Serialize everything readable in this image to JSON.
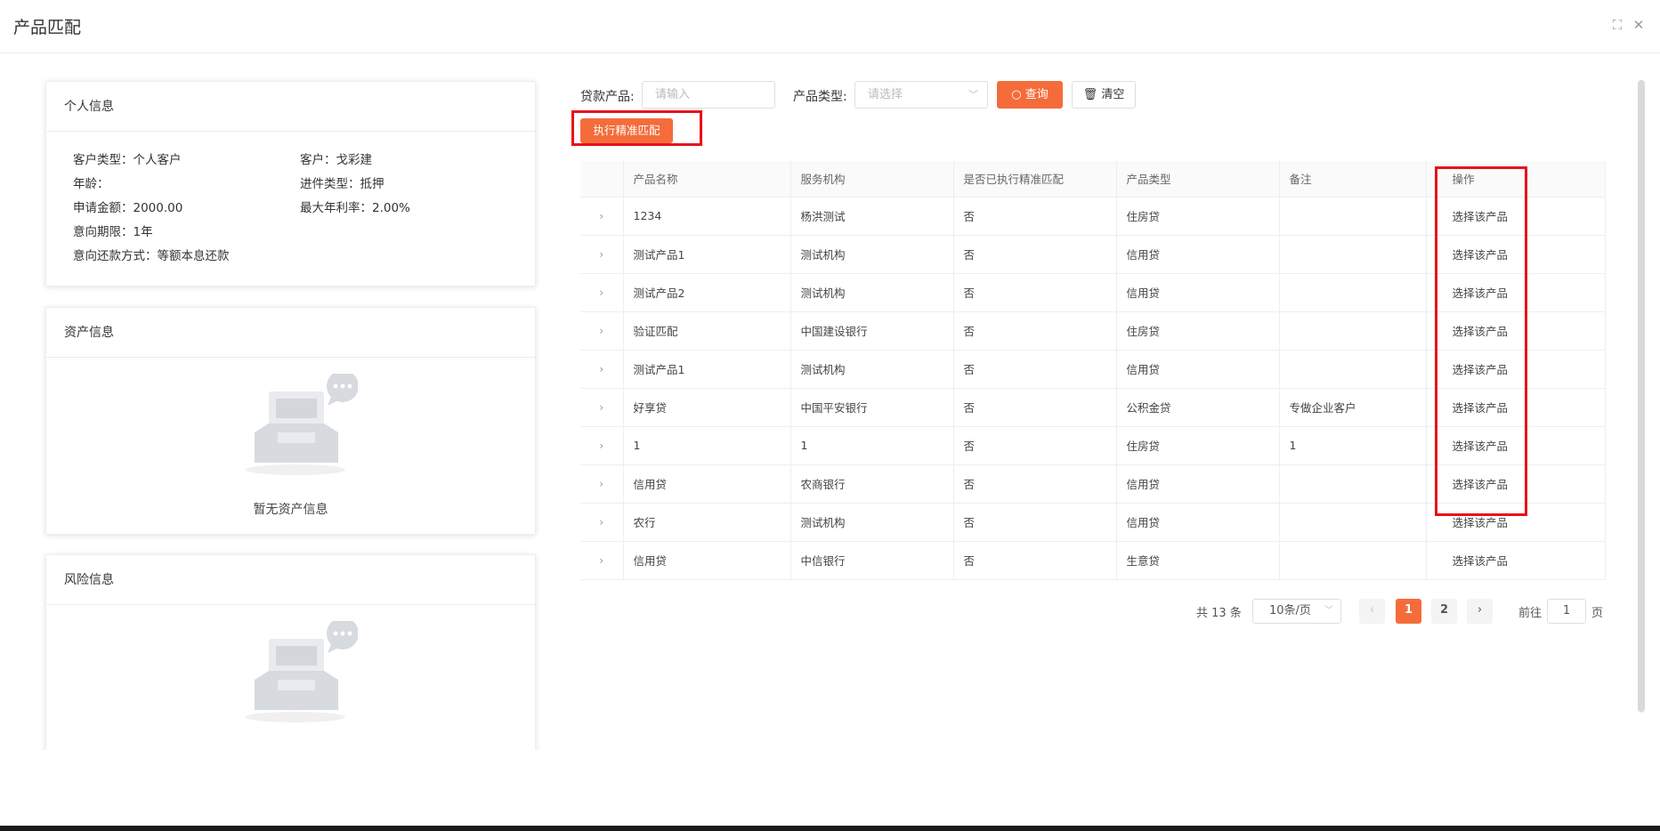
{
  "dialog": {
    "title": "产品匹配",
    "maximize_icon": "maximize-icon",
    "close_icon": "close-icon"
  },
  "personal": {
    "title": "个人信息",
    "customer_type": "客户类型：个人客户",
    "customer": "客户：戈彩建",
    "age": "年龄：",
    "loan_type": "进件类型：抵押",
    "amount": "申请金额：2000.00",
    "max_rate": "最大年利率：2.00%",
    "term": "意向期限：1年",
    "repayment": "意向还款方式：等额本息还款"
  },
  "assets": {
    "title": "资产信息",
    "empty_text": "暂无资产信息"
  },
  "risk": {
    "title": "风险信息"
  },
  "search": {
    "loan_product_label": "贷款产品:",
    "loan_product_placeholder": "请输入",
    "product_type_label": "产品类型:",
    "product_type_placeholder": "请选择",
    "query_label": "查询",
    "clear_label": "清空",
    "precise_match_label": "执行精准匹配"
  },
  "table": {
    "columns": [
      "产品名称",
      "服务机构",
      "是否已执行精准匹配",
      "产品类型",
      "备注",
      "操作"
    ],
    "rows": [
      {
        "name": "1234",
        "org": "杨洪测试",
        "matched": "否",
        "type": "住房贷",
        "note": "",
        "action": "选择该产品"
      },
      {
        "name": "测试产品1",
        "org": "测试机构",
        "matched": "否",
        "type": "信用贷",
        "note": "",
        "action": "选择该产品"
      },
      {
        "name": "测试产品2",
        "org": "测试机构",
        "matched": "否",
        "type": "信用贷",
        "note": "",
        "action": "选择该产品"
      },
      {
        "name": "验证匹配",
        "org": "中国建设银行",
        "matched": "否",
        "type": "住房贷",
        "note": "",
        "action": "选择该产品"
      },
      {
        "name": "测试产品1",
        "org": "测试机构",
        "matched": "否",
        "type": "信用贷",
        "note": "",
        "action": "选择该产品"
      },
      {
        "name": "好享贷",
        "org": "中国平安银行",
        "matched": "否",
        "type": "公积金贷",
        "note": "专做企业客户",
        "action": "选择该产品"
      },
      {
        "name": "1",
        "org": "1",
        "matched": "否",
        "type": "住房贷",
        "note": "1",
        "action": "选择该产品"
      },
      {
        "name": "信用贷",
        "org": "农商银行",
        "matched": "否",
        "type": "信用贷",
        "note": "",
        "action": "选择该产品"
      },
      {
        "name": "农行",
        "org": "测试机构",
        "matched": "否",
        "type": "信用贷",
        "note": "",
        "action": "选择该产品"
      },
      {
        "name": "信用贷",
        "org": "中信银行",
        "matched": "否",
        "type": "生意贷",
        "note": "",
        "action": "选择该产品"
      }
    ]
  },
  "pagination": {
    "total": "共 13 条",
    "page_size": "10条/页",
    "pages": [
      "1",
      "2"
    ],
    "current_page": "1",
    "goto_label": "前往",
    "goto_value": "1",
    "page_suffix": "页"
  },
  "colors": {
    "accent": "#f56c3b",
    "highlight": "#e8101a"
  }
}
